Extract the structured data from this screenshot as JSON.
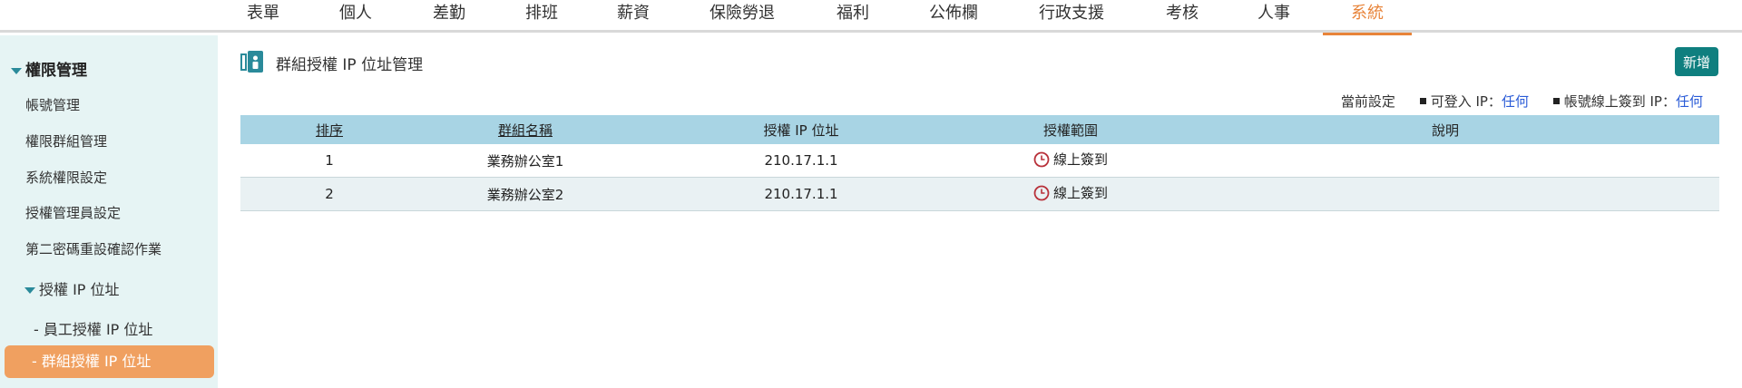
{
  "topnav": {
    "tabs": [
      {
        "label": "表單"
      },
      {
        "label": "個人"
      },
      {
        "label": "差勤"
      },
      {
        "label": "排班"
      },
      {
        "label": "薪資"
      },
      {
        "label": "保險勞退"
      },
      {
        "label": "福利"
      },
      {
        "label": "公佈欄"
      },
      {
        "label": "行政支援"
      },
      {
        "label": "考核"
      },
      {
        "label": "人事"
      },
      {
        "label": "系統"
      }
    ],
    "active_tab": "系統",
    "active_color": "#e8843a"
  },
  "sidebar": {
    "group_label": "權限管理",
    "items": [
      {
        "label": "帳號管理"
      },
      {
        "label": "權限群組管理"
      },
      {
        "label": "系統權限設定"
      },
      {
        "label": "授權管理員設定"
      },
      {
        "label": "第二密碼重設確認作業"
      }
    ],
    "subgroup_label": "授權 IP 位址",
    "subitems": [
      {
        "label": "- 員工授權 IP 位址"
      },
      {
        "label": "- 群組授權 IP 位址"
      }
    ],
    "active_color": "#f0a060"
  },
  "main": {
    "title": "群組授權 IP 位址管理",
    "title_icon": "address-book-icon",
    "add_button": "新增",
    "settings": {
      "label": "當前設定",
      "login_label": "可登入 IP：",
      "login_value": "任何",
      "checkin_label": "帳號線上簽到 IP：",
      "checkin_value": "任何"
    },
    "table": {
      "headers": [
        "排序",
        "群組名稱",
        "授權 IP 位址",
        "授權範圍",
        "說明"
      ],
      "rows": [
        {
          "order": "1",
          "group": "業務辦公室1",
          "ip": "210.17.1.1",
          "scope": "線上簽到",
          "scope_icon": "clock-icon",
          "note": ""
        },
        {
          "order": "2",
          "group": "業務辦公室2",
          "ip": "210.17.1.1",
          "scope": "線上簽到",
          "scope_icon": "clock-icon",
          "note": ""
        }
      ]
    }
  }
}
